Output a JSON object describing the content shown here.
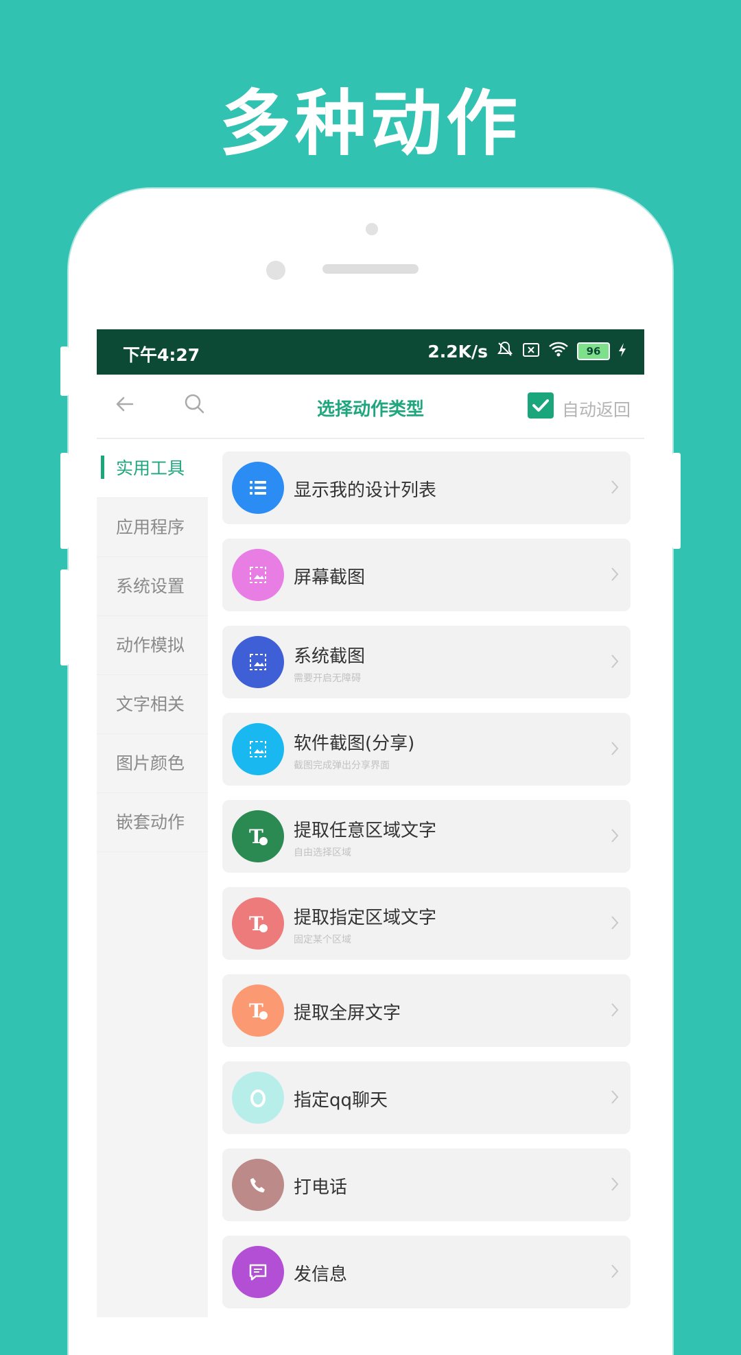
{
  "promo": {
    "title": "多种动作"
  },
  "status_bar": {
    "time": "下午4:27",
    "net_speed": "2.2K/s",
    "battery": "96"
  },
  "app_bar": {
    "title": "选择动作类型",
    "auto_return_label": "自动返回",
    "auto_return_checked": true
  },
  "sidebar": {
    "items": [
      {
        "label": "实用工具",
        "active": true
      },
      {
        "label": "应用程序"
      },
      {
        "label": "系统设置"
      },
      {
        "label": "动作模拟"
      },
      {
        "label": "文字相关"
      },
      {
        "label": "图片颜色"
      },
      {
        "label": "嵌套动作"
      }
    ]
  },
  "actions": [
    {
      "title": "显示我的设计列表",
      "subtitle": "",
      "icon": "list-icon",
      "color": "#2b8cf4"
    },
    {
      "title": "屏幕截图",
      "subtitle": "",
      "icon": "screenshot-icon",
      "color": "#e87ee3"
    },
    {
      "title": "系统截图",
      "subtitle": "需要开启无障碍",
      "icon": "screenshot-icon",
      "color": "#3e5fd6"
    },
    {
      "title": "软件截图(分享)",
      "subtitle": "截图完成弹出分享界面",
      "icon": "screenshot-icon",
      "color": "#1ab8f0"
    },
    {
      "title": "提取任意区域文字",
      "subtitle": "自由选择区域",
      "icon": "text-extract-icon",
      "color": "#2a8a52"
    },
    {
      "title": "提取指定区域文字",
      "subtitle": "固定某个区域",
      "icon": "text-extract-icon",
      "color": "#ee7b7b"
    },
    {
      "title": "提取全屏文字",
      "subtitle": "",
      "icon": "text-extract-icon",
      "color": "#fb9a72"
    },
    {
      "title": "指定qq聊天",
      "subtitle": "",
      "icon": "qq-icon",
      "color": "#b8eeea"
    },
    {
      "title": "打电话",
      "subtitle": "",
      "icon": "phone-icon",
      "color": "#bc8a88"
    },
    {
      "title": "发信息",
      "subtitle": "",
      "icon": "message-icon",
      "color": "#b24fd4"
    }
  ]
}
